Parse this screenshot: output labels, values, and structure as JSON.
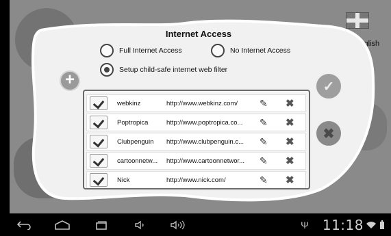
{
  "dialog": {
    "title": "Internet Access",
    "options": [
      {
        "label": "Full Internet Access",
        "selected": false
      },
      {
        "label": "No Internet Access",
        "selected": false
      },
      {
        "label": "Setup child-safe internet web filter",
        "selected": true
      }
    ]
  },
  "sites": [
    {
      "name": "webkinz",
      "url": "http://www.webkinz.com/",
      "checked": true
    },
    {
      "name": "Poptropica",
      "url": "http://www.poptropica.co...",
      "checked": true
    },
    {
      "name": "Clubpenguin",
      "url": "http://www.clubpenguin.c...",
      "checked": true
    },
    {
      "name": "cartoonnetw...",
      "url": "http://www.cartoonnetwor...",
      "checked": true
    },
    {
      "name": "Nick",
      "url": "http://www.nick.com/",
      "checked": true
    }
  ],
  "language": {
    "label": "English"
  },
  "status_bar": {
    "time": "11:18"
  },
  "icons": {
    "add": "plus-icon",
    "confirm": "check-icon",
    "cancel": "x-icon",
    "edit": "pencil-icon",
    "delete": "cross-icon",
    "back": "back-icon",
    "home": "home-icon",
    "recents": "recent-apps-icon",
    "volume_down": "volume-down-icon",
    "volume_up": "volume-up-icon",
    "usb": "usb-icon",
    "wifi": "wifi-icon",
    "battery": "battery-icon"
  }
}
